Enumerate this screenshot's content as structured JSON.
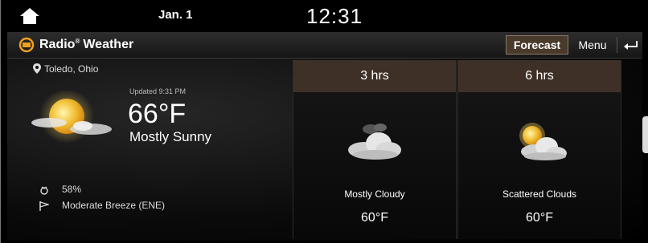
{
  "status": {
    "date": "Jan. 1",
    "time": "12:31"
  },
  "app": {
    "title_brand": "Radio",
    "title_name": "Weather",
    "forecast_label": "Forecast",
    "menu_label": "Menu"
  },
  "current": {
    "location": "Toledo, Ohio",
    "updated": "Updated 9:31 PM",
    "temperature": "66°F",
    "condition": "Mostly Sunny",
    "humidity": "58%",
    "wind": "Moderate Breeze (ENE)"
  },
  "forecast": [
    {
      "period": "3 hrs",
      "condition": "Mostly Cloudy",
      "temperature": "60°F",
      "icon": "cloudy-icon"
    },
    {
      "period": "6 hrs",
      "condition": "Scattered Clouds",
      "temperature": "60°F",
      "icon": "partly-sunny-icon"
    }
  ],
  "colors": {
    "card_header": "#3f3027",
    "forecast_button": "#4a3a2c",
    "background": "#000000"
  }
}
